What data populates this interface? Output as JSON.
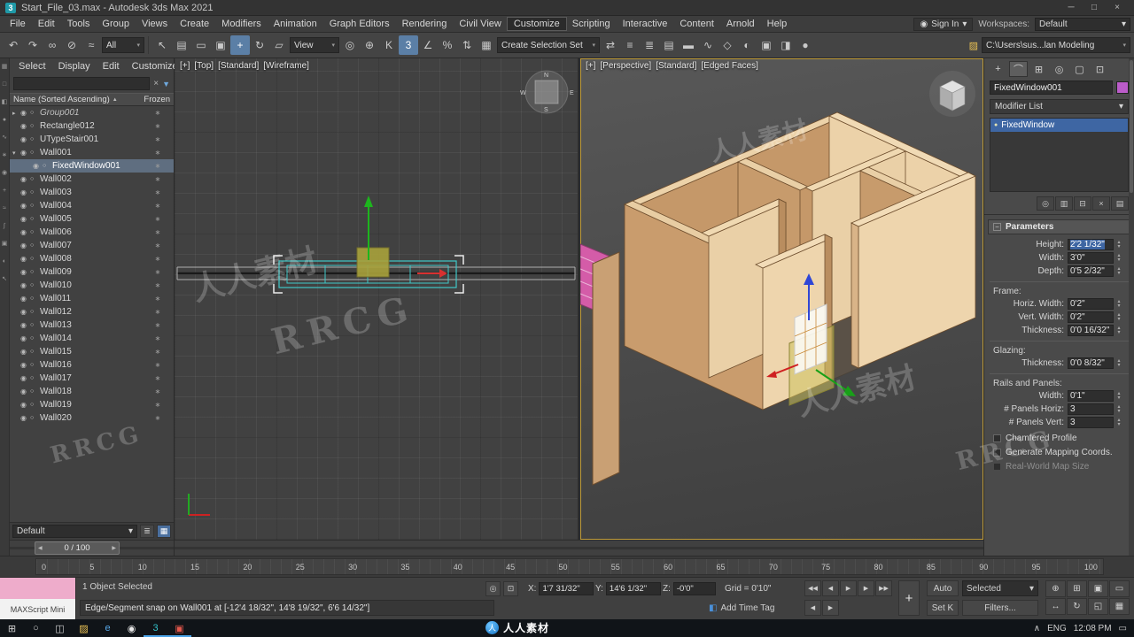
{
  "icons": {
    "eye": "◉",
    "type_dot": "○",
    "frozen": "∗",
    "search_clear": "×",
    "filter_funnel": "▼",
    "sort_arrow": "▲",
    "spin_up": "▴",
    "spin_down": "▾",
    "caret_down": "▾",
    "list_menu": "≣",
    "grid_view": "▦",
    "bulb": "●",
    "signin_person": "◉",
    "search": "○"
  },
  "colors": {
    "selection_blue": "#3e66a3",
    "object_color": "#bb5cc9",
    "accent": "#5b7fa6"
  },
  "titlebar": {
    "icon": "3",
    "title": "Start_File_03.max - Autodesk 3ds Max 2021",
    "minimize": "─",
    "maximize": "□",
    "close": "×"
  },
  "menubar": {
    "items": [
      {
        "label": "File"
      },
      {
        "label": "Edit"
      },
      {
        "label": "Tools"
      },
      {
        "label": "Group"
      },
      {
        "label": "Views"
      },
      {
        "label": "Create"
      },
      {
        "label": "Modifiers"
      },
      {
        "label": "Animation"
      },
      {
        "label": "Graph Editors"
      },
      {
        "label": "Rendering"
      },
      {
        "label": "Civil View"
      },
      {
        "label": "Customize",
        "cls": "active"
      },
      {
        "label": "Scripting"
      },
      {
        "label": "Interactive"
      },
      {
        "label": "Content"
      },
      {
        "label": "Arnold"
      },
      {
        "label": "Help"
      }
    ],
    "signin": "Sign In",
    "workspaces_label": "Workspaces:",
    "workspace_value": "Default"
  },
  "toolbar": {
    "icons_a": [
      {
        "n": "undo-icon",
        "g": "↶"
      },
      {
        "n": "redo-icon",
        "g": "↷"
      },
      {
        "n": "select-and-link-icon",
        "g": "∞"
      },
      {
        "n": "unlink-selection-icon",
        "g": "⊘"
      },
      {
        "n": "bind-to-space-warp-icon",
        "g": "≈"
      }
    ],
    "filter_value": "All",
    "icons_b": [
      {
        "n": "select-object-icon",
        "g": "↖"
      },
      {
        "n": "select-by-name-icon",
        "g": "▤"
      },
      {
        "n": "rectangular-selection-icon",
        "g": "▭"
      },
      {
        "n": "window-crossing-icon",
        "g": "▣"
      },
      {
        "n": "select-and-move-icon",
        "g": "+",
        "cls": "active"
      },
      {
        "n": "select-and-rotate-icon",
        "g": "↻"
      },
      {
        "n": "select-and-scale-icon",
        "g": "▱"
      }
    ],
    "coord_value": "View",
    "icons_c": [
      {
        "n": "use-pivot-center-icon",
        "g": "◎"
      },
      {
        "n": "select-and-manipulate-icon",
        "g": "⊕"
      },
      {
        "n": "keyboard-override-icon",
        "g": "K"
      },
      {
        "n": "snaps-toggle-icon",
        "g": "3",
        "cls": "active"
      },
      {
        "n": "angle-snap-icon",
        "g": "∠"
      },
      {
        "n": "percent-snap-icon",
        "g": "%"
      },
      {
        "n": "spinner-snap-icon",
        "g": "⇅"
      },
      {
        "n": "edit-selection-sets-icon",
        "g": "▦"
      }
    ],
    "selection_set_value": "Create Selection Set",
    "icons_d": [
      {
        "n": "mirror-icon",
        "g": "⇄"
      },
      {
        "n": "align-icon",
        "g": "≡"
      },
      {
        "n": "scene-explorer-toggle-icon",
        "g": "≣"
      },
      {
        "n": "layer-explorer-icon",
        "g": "▤"
      },
      {
        "n": "ribbon-icon",
        "g": "▬"
      },
      {
        "n": "curve-editor-icon",
        "g": "∿"
      },
      {
        "n": "schematic-view-icon",
        "g": "◇"
      },
      {
        "n": "material-editor-icon",
        "g": "◐"
      },
      {
        "n": "render-setup-icon",
        "g": "▣"
      },
      {
        "n": "rendered-frame-icon",
        "g": "◨"
      },
      {
        "n": "render-icon",
        "g": "●"
      }
    ],
    "project_folder_icon": "▨",
    "project_path": "C:\\Users\\sus...lan Modeling"
  },
  "strip": [
    {
      "n": "select-all-icon",
      "g": "▦"
    },
    {
      "n": "select-none-icon",
      "g": "□"
    },
    {
      "n": "select-invert-icon",
      "g": "◧"
    },
    {
      "n": "display-geometry-icon",
      "g": "●"
    },
    {
      "n": "display-shapes-icon",
      "g": "∿"
    },
    {
      "n": "display-lights-icon",
      "g": "∗"
    },
    {
      "n": "display-cameras-icon",
      "g": "◉"
    },
    {
      "n": "display-helpers-icon",
      "g": "+"
    },
    {
      "n": "display-spacewarps-icon",
      "g": "≈"
    },
    {
      "n": "display-bones-icon",
      "g": "∫"
    },
    {
      "n": "display-containers-icon",
      "g": "▣"
    },
    {
      "n": "display-materials-icon",
      "g": "◐"
    },
    {
      "n": "pick-parent-icon",
      "g": "↖"
    }
  ],
  "explorer": {
    "tabs": [
      {
        "label": "Select"
      },
      {
        "label": "Display"
      },
      {
        "label": "Edit"
      },
      {
        "label": "Customize"
      }
    ],
    "name_column": "Name (Sorted Ascending)",
    "frozen_column": "Frozen",
    "rows": [
      {
        "arrow": "▸",
        "label": "Group001",
        "cls": "italic"
      },
      {
        "arrow": "",
        "label": "Rectangle012"
      },
      {
        "arrow": "",
        "label": "UTypeStair001"
      },
      {
        "arrow": "▾",
        "label": "Wall001"
      },
      {
        "arrow": "",
        "label": "FixedWindow001",
        "cls": "sel child"
      },
      {
        "arrow": "",
        "label": "Wall002"
      },
      {
        "arrow": "",
        "label": "Wall003"
      },
      {
        "arrow": "",
        "label": "Wall004"
      },
      {
        "arrow": "",
        "label": "Wall005"
      },
      {
        "arrow": "",
        "label": "Wall006"
      },
      {
        "arrow": "",
        "label": "Wall007"
      },
      {
        "arrow": "",
        "label": "Wall008"
      },
      {
        "arrow": "",
        "label": "Wall009"
      },
      {
        "arrow": "",
        "label": "Wall010"
      },
      {
        "arrow": "",
        "label": "Wall011"
      },
      {
        "arrow": "",
        "label": "Wall012"
      },
      {
        "arrow": "",
        "label": "Wall013"
      },
      {
        "arrow": "",
        "label": "Wall014"
      },
      {
        "arrow": "",
        "label": "Wall015"
      },
      {
        "arrow": "",
        "label": "Wall016"
      },
      {
        "arrow": "",
        "label": "Wall017"
      },
      {
        "arrow": "",
        "label": "Wall018"
      },
      {
        "arrow": "",
        "label": "Wall019"
      },
      {
        "arrow": "",
        "label": "Wall020"
      }
    ],
    "display_value": "Default"
  },
  "viewports": {
    "top": {
      "labels": [
        {
          "t": "[+]"
        },
        {
          "t": "[Top]"
        },
        {
          "t": "[Standard]"
        },
        {
          "t": "[Wireframe]"
        }
      ],
      "compass": {
        "n": "N",
        "e": "E",
        "s": "S",
        "w": "W"
      }
    },
    "persp": {
      "labels": [
        {
          "t": "[+]"
        },
        {
          "t": "[Perspective]"
        },
        {
          "t": "[Standard]"
        },
        {
          "t": "[Edged Faces]"
        }
      ]
    }
  },
  "command_panel": {
    "tabs": [
      {
        "n": "create-tab-icon",
        "g": "+"
      },
      {
        "n": "modify-tab-icon",
        "g": "⌒",
        "cls": "active"
      },
      {
        "n": "hierarchy-tab-icon",
        "g": "⊞"
      },
      {
        "n": "motion-tab-icon",
        "g": "◎"
      },
      {
        "n": "display-tab-icon",
        "g": "▢"
      },
      {
        "n": "utilities-tab-icon",
        "g": "⊡"
      }
    ],
    "object_name": "FixedWindow001",
    "modifier_list_label": "Modifier List",
    "stack": [
      {
        "label": "FixedWindow",
        "cls": "selected"
      }
    ],
    "stack_buttons": [
      {
        "n": "pin-stack-icon",
        "g": "◎"
      },
      {
        "n": "show-end-result-icon",
        "g": "▥"
      },
      {
        "n": "make-unique-icon",
        "g": "⊟"
      },
      {
        "n": "remove-modifier-icon",
        "g": "×"
      },
      {
        "n": "configure-modifier-sets-icon",
        "g": "▤"
      }
    ],
    "rollout_title": "Parameters",
    "params": [
      {
        "label": "Height:",
        "value": "2'2 1/32\"",
        "cls": "hl"
      },
      {
        "label": "Width:",
        "value": "3'0\""
      },
      {
        "label": "Depth:",
        "value": "0'5 2/32\""
      }
    ],
    "frame_group": {
      "title": "Frame:",
      "params": [
        {
          "label": "Horiz. Width:",
          "value": "0'2\""
        },
        {
          "label": "Vert. Width:",
          "value": "0'2\""
        },
        {
          "label": "Thickness:",
          "value": "0'0 16/32\""
        }
      ]
    },
    "glazing_group": {
      "title": "Glazing:",
      "params": [
        {
          "label": "Thickness:",
          "value": "0'0 8/32\""
        }
      ]
    },
    "rails_group": {
      "title": "Rails and Panels:",
      "params": [
        {
          "label": "Width:",
          "value": "0'1\""
        },
        {
          "label": "# Panels Horiz:",
          "value": "3"
        },
        {
          "label": "# Panels Vert:",
          "value": "3"
        }
      ]
    },
    "checkboxes": [
      {
        "label": "Chamfered Profile"
      },
      {
        "label": "Generate Mapping Coords."
      },
      {
        "label": "Real-World Map Size",
        "cls": "disabled"
      }
    ]
  },
  "timeline": {
    "slider_prev": "◀",
    "slider_value": "0 / 100",
    "slider_next": "▶",
    "ticks": [
      "0",
      "5",
      "10",
      "15",
      "20",
      "25",
      "30",
      "35",
      "40",
      "45",
      "50",
      "55",
      "60",
      "65",
      "70",
      "75",
      "80",
      "85",
      "90",
      "95",
      "100"
    ]
  },
  "statusbar": {
    "maxscript_label": "MAXScript Mini",
    "selection_status": "1 Object Selected",
    "prompt": "Edge/Segment snap on Wall001 at [-12'4 18/32\", 14'8 19/32\", 6'6 14/32\"]",
    "isolate_icon": "◎",
    "lock_icon": "⊡",
    "x_label": "X:",
    "x_value": "1'7 31/32\"",
    "y_label": "Y:",
    "y_value": "14'6 1/32\"",
    "z_label": "Z:",
    "z_value": "-0'0\"",
    "grid_text": "Grid = 0'10\"",
    "tag_icon": "◧",
    "add_time_tag": "Add Time Tag",
    "playback": [
      {
        "n": "go-to-start-button",
        "g": "◀◀"
      },
      {
        "n": "previous-frame-button",
        "g": "◀"
      },
      {
        "n": "play-button",
        "g": "▶"
      },
      {
        "n": "next-frame-button",
        "g": "▶"
      },
      {
        "n": "go-to-end-button",
        "g": "▶▶"
      }
    ],
    "frame_step": [
      {
        "n": "key-step-back-button",
        "g": "◀"
      },
      {
        "n": "key-step-forward-button",
        "g": "▶"
      }
    ],
    "set_keys_button": "+",
    "auto_key": "Auto",
    "selected_dropdown": "Selected",
    "set_key": "Set K",
    "key_filters": "Filters...",
    "nav": [
      {
        "n": "zoom-icon",
        "g": "⊕"
      },
      {
        "n": "zoom-all-icon",
        "g": "⊞"
      },
      {
        "n": "zoom-extents-icon",
        "g": "▣"
      },
      {
        "n": "zoom-region-icon",
        "g": "▭"
      },
      {
        "n": "pan-icon",
        "g": "↔"
      },
      {
        "n": "orbit-icon",
        "g": "↻"
      },
      {
        "n": "maximize-viewport-icon",
        "g": "◱"
      },
      {
        "n": "viewport-config-icon",
        "g": "▦"
      }
    ]
  },
  "taskbar": {
    "start_icon": "⊞",
    "apps": [
      {
        "n": "search-icon",
        "g": "○",
        "c": "#cfcfcf"
      },
      {
        "n": "task-view-icon",
        "g": "◫",
        "c": "#cfcfcf"
      },
      {
        "n": "file-explorer-icon",
        "g": "▨",
        "c": "#eac254"
      },
      {
        "n": "edge-icon",
        "g": "e",
        "c": "#57a8e8"
      },
      {
        "n": "browser-icon",
        "g": "◉",
        "c": "#e8e8e8"
      },
      {
        "n": "3dsmax-icon",
        "g": "3",
        "c": "#34c3cb",
        "cls": "open"
      },
      {
        "n": "media-app-icon",
        "g": "▣",
        "c": "#e2574c",
        "cls": "open"
      }
    ],
    "tray_expand": "∧",
    "lang": "ENG",
    "time": "12:08 PM",
    "notification_icon": "▭"
  },
  "watermarks": {
    "cn": "人人素材",
    "en": "RRCG",
    "logo": "人"
  }
}
